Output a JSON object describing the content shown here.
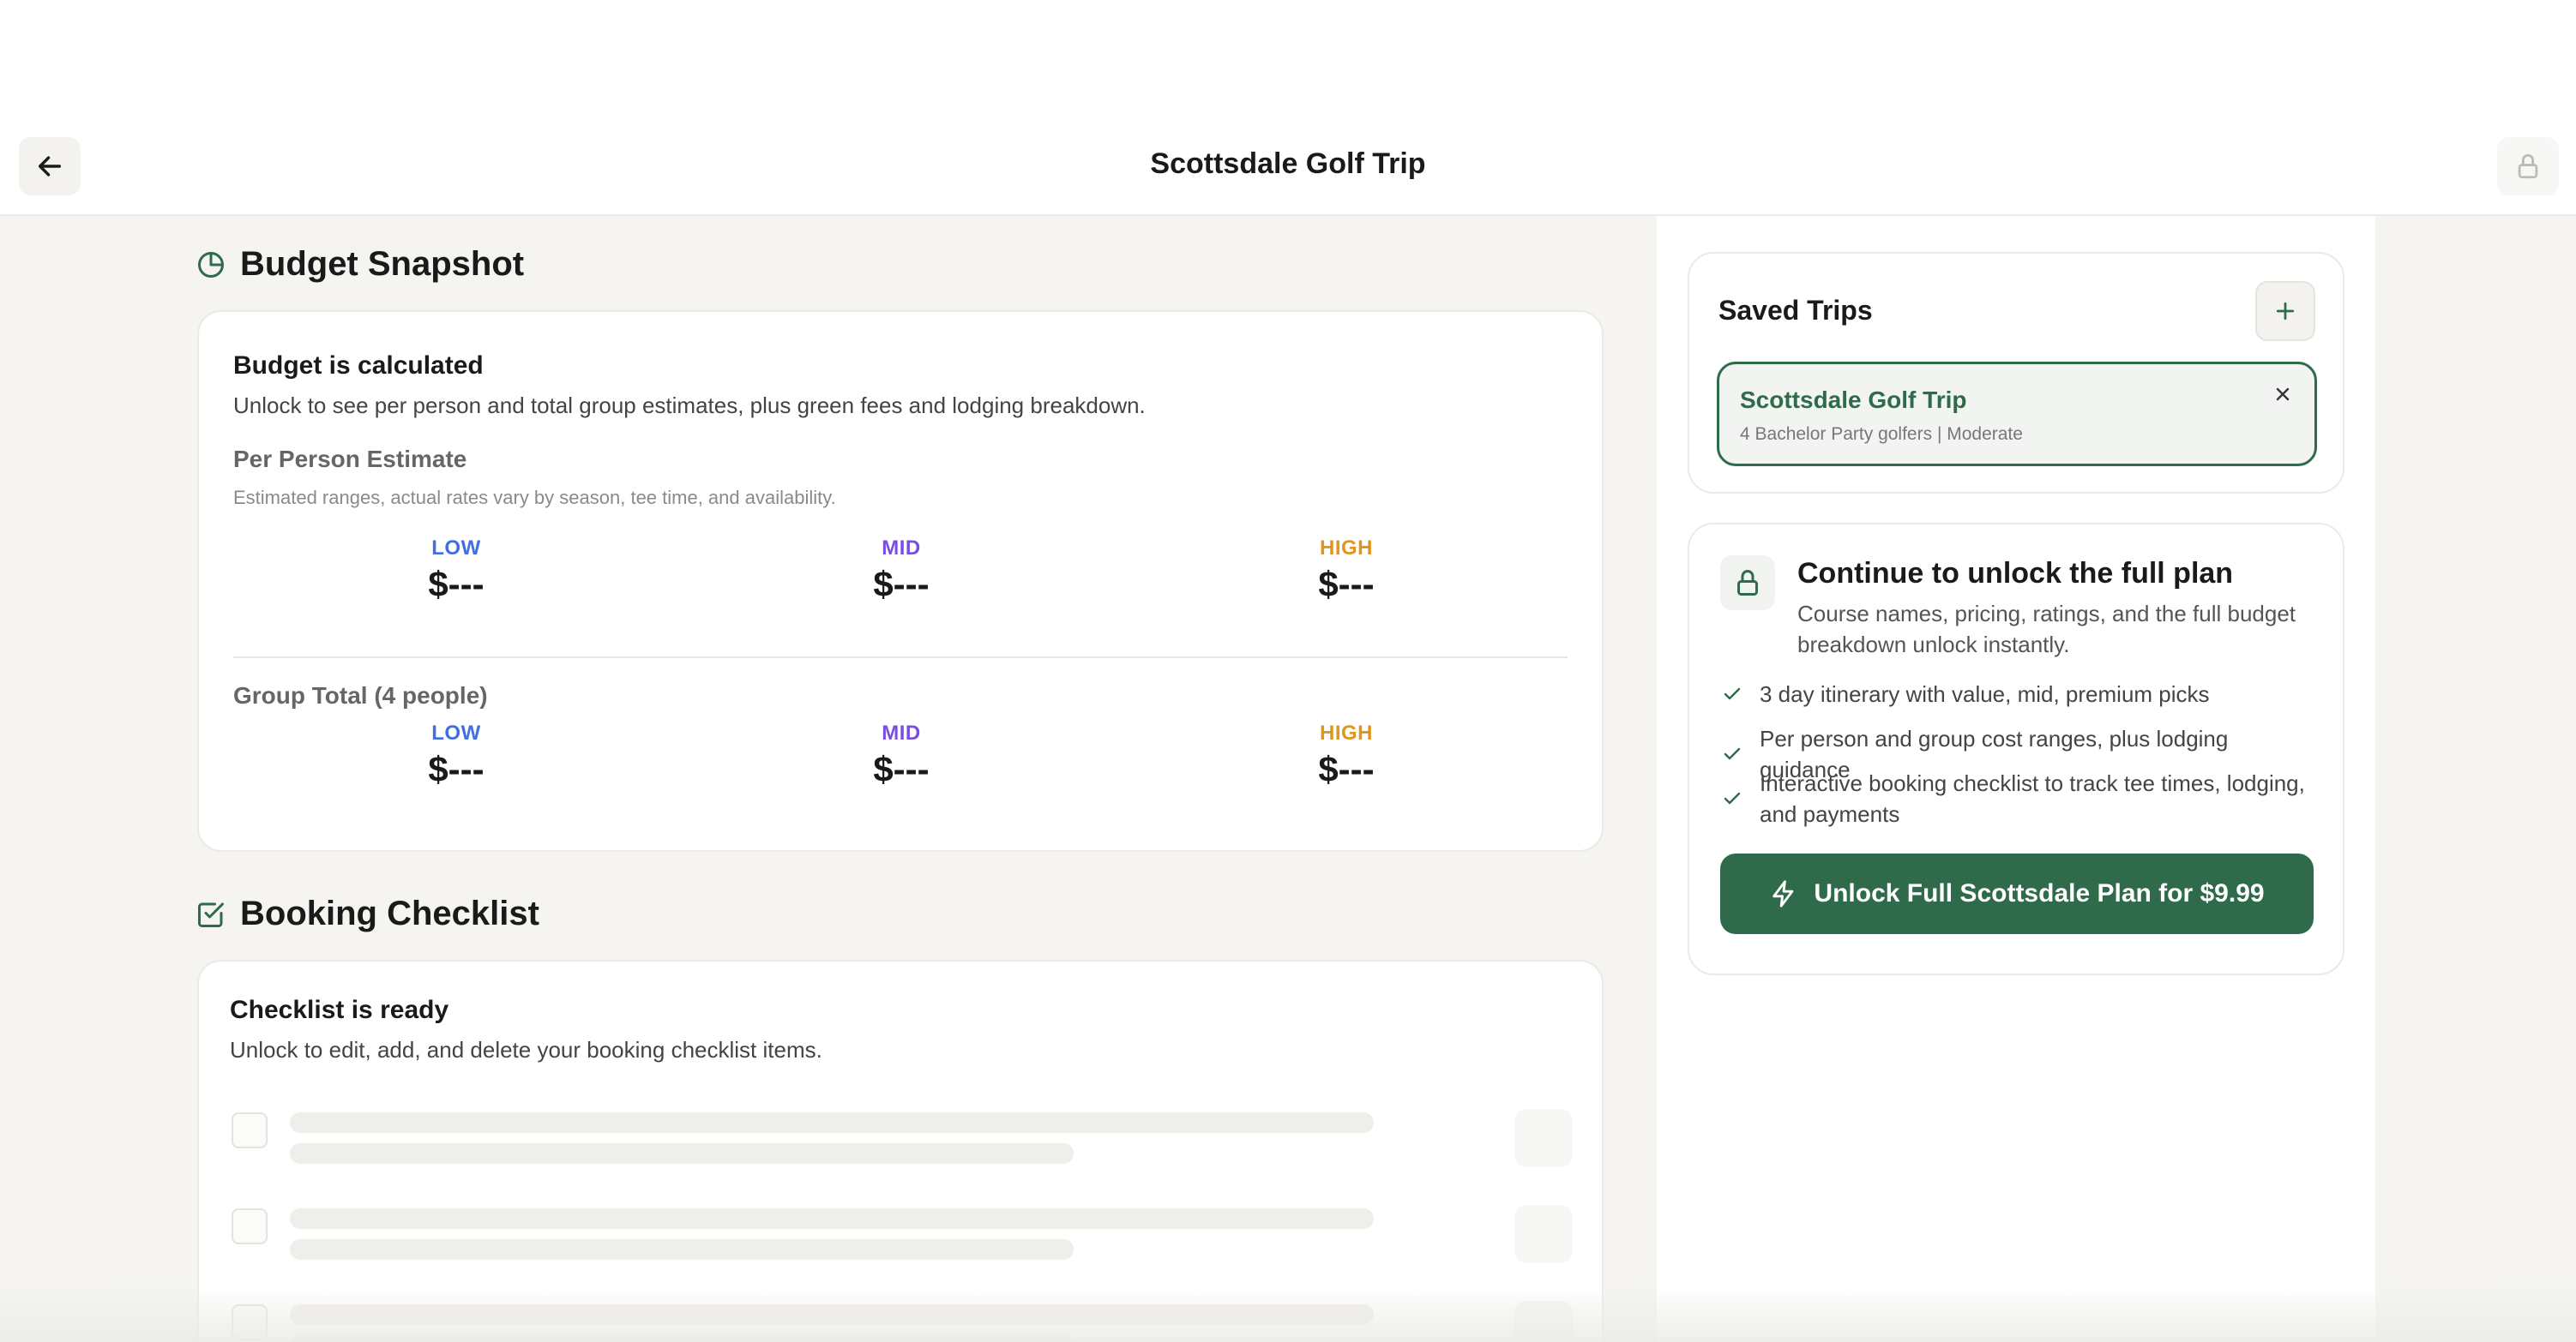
{
  "header": {
    "title": "Scottsdale Golf Trip"
  },
  "budget": {
    "section_title": "Budget Snapshot",
    "card_title": "Budget is calculated",
    "card_text": "Unlock to see per person and total group estimates, plus green fees and lodging breakdown.",
    "per_person": {
      "title": "Per Person Estimate",
      "note": "Estimated ranges, actual rates vary by season, tee time, and availability.",
      "tiers": [
        {
          "label": "LOW",
          "value": "$---"
        },
        {
          "label": "MID",
          "value": "$---"
        },
        {
          "label": "HIGH",
          "value": "$---"
        }
      ]
    },
    "group": {
      "title": "Group Total (4 people)",
      "tiers": [
        {
          "label": "LOW",
          "value": "$---"
        },
        {
          "label": "MID",
          "value": "$---"
        },
        {
          "label": "HIGH",
          "value": "$---"
        }
      ]
    }
  },
  "checklist": {
    "section_title": "Booking Checklist",
    "card_title": "Checklist is ready",
    "card_text": "Unlock to edit, add, and delete your booking checklist items."
  },
  "saved_trips": {
    "title": "Saved Trips",
    "items": [
      {
        "name": "Scottsdale Golf Trip",
        "meta": "4 Bachelor Party golfers | Moderate"
      }
    ]
  },
  "unlock": {
    "title": "Continue to unlock the full plan",
    "text": "Course names, pricing, ratings, and the full budget breakdown unlock instantly.",
    "features": [
      "3 day itinerary with value, mid, premium picks",
      "Per person and group cost ranges, plus lodging guidance",
      "Interactive booking checklist to track tee times, lodging, and payments"
    ],
    "cta_label": "Unlock Full Scottsdale Plan for $9.99"
  },
  "colors": {
    "brand_green": "#2f6a4a",
    "low": "#3f6fe0",
    "mid": "#7a4ee0",
    "high": "#e0951f"
  }
}
